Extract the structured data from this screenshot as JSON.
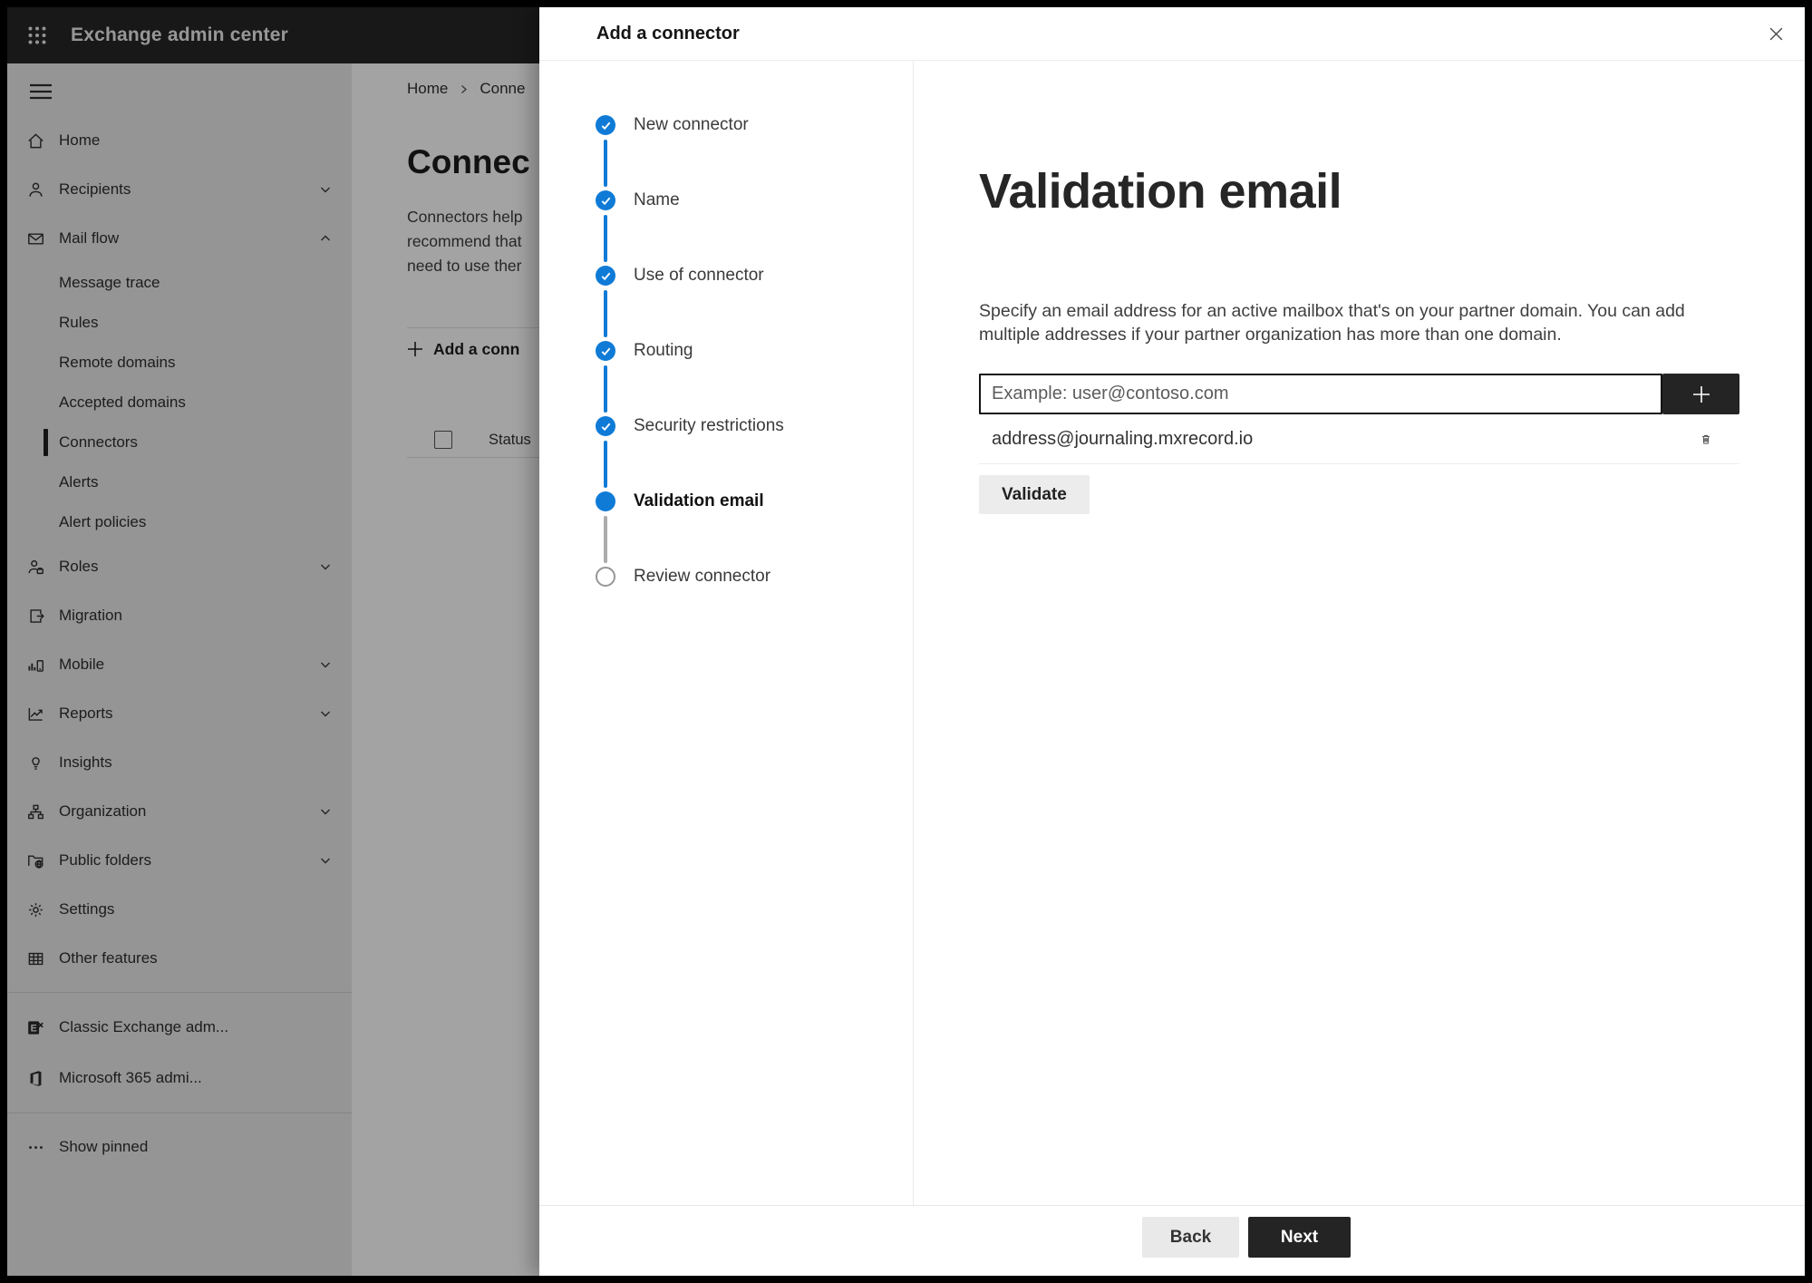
{
  "topbar": {
    "app_title": "Exchange admin center"
  },
  "sidebar": {
    "items": [
      {
        "label": "Home"
      },
      {
        "label": "Recipients",
        "chevron": "down"
      },
      {
        "label": "Mail flow",
        "chevron": "up"
      },
      {
        "label": "Message trace",
        "sub": true
      },
      {
        "label": "Rules",
        "sub": true
      },
      {
        "label": "Remote domains",
        "sub": true
      },
      {
        "label": "Accepted domains",
        "sub": true
      },
      {
        "label": "Connectors",
        "sub": true,
        "selected": true
      },
      {
        "label": "Alerts",
        "sub": true
      },
      {
        "label": "Alert policies",
        "sub": true
      },
      {
        "label": "Roles",
        "chevron": "down"
      },
      {
        "label": "Migration"
      },
      {
        "label": "Mobile",
        "chevron": "down"
      },
      {
        "label": "Reports",
        "chevron": "down"
      },
      {
        "label": "Insights"
      },
      {
        "label": "Organization",
        "chevron": "down"
      },
      {
        "label": "Public folders",
        "chevron": "down"
      },
      {
        "label": "Settings"
      },
      {
        "label": "Other features"
      },
      {
        "label": "Classic Exchange adm..."
      },
      {
        "label": "Microsoft 365 admi..."
      },
      {
        "label": "Show pinned"
      }
    ]
  },
  "page": {
    "breadcrumb": {
      "home": "Home",
      "current": "Conne"
    },
    "title": "Connec",
    "description_lines": {
      "l1": "Connectors help",
      "l2": "recommend that",
      "l3": "need to use ther"
    },
    "toolbar": {
      "add_button": "Add a conn"
    },
    "table": {
      "status_header": "Status"
    }
  },
  "dialog": {
    "title": "Add a connector",
    "steps": [
      {
        "label": "New connector",
        "state": "done"
      },
      {
        "label": "Name",
        "state": "done"
      },
      {
        "label": "Use of connector",
        "state": "done"
      },
      {
        "label": "Routing",
        "state": "done"
      },
      {
        "label": "Security restrictions",
        "state": "done"
      },
      {
        "label": "Validation email",
        "state": "current"
      },
      {
        "label": "Review connector",
        "state": "upcoming"
      }
    ],
    "content": {
      "heading": "Validation email",
      "description": "Specify an email address for an active mailbox that's on your partner domain. You can add multiple addresses if your partner organization has more than one domain.",
      "email_input": {
        "value": "",
        "placeholder": "Example: user@contoso.com"
      },
      "addresses": {
        "first": "address@journaling.mxrecord.io"
      },
      "validate_button": "Validate"
    },
    "footer": {
      "back_button": "Back",
      "next_button": "Next"
    }
  },
  "colors": {
    "accent_blue": "#0f7bd7",
    "primary_dark": "#242424",
    "topbar_bg": "#262626"
  }
}
